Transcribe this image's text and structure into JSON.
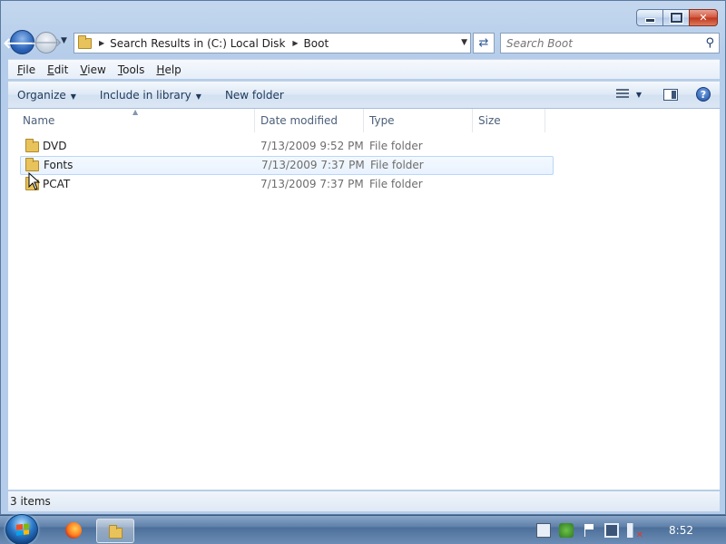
{
  "window": {
    "controls": {
      "minimize": "",
      "maximize": "",
      "close": "✕"
    }
  },
  "navbar": {
    "back_glyph": "🡐",
    "forward_glyph": "🡒",
    "breadcrumbs": [
      {
        "label": "Search Results in (C:) Local Disk"
      },
      {
        "label": "Boot"
      }
    ],
    "refresh_glyph": "⇄",
    "search_placeholder": "Search Boot",
    "search_glyph": "⚲"
  },
  "menubar": {
    "items": [
      {
        "key": "F",
        "rest": "ile"
      },
      {
        "key": "E",
        "rest": "dit"
      },
      {
        "key": "V",
        "rest": "iew"
      },
      {
        "key": "T",
        "rest": "ools"
      },
      {
        "key": "H",
        "rest": "elp"
      }
    ]
  },
  "cmdbar": {
    "organize": "Organize",
    "include": "Include in library",
    "new_folder": "New folder",
    "help_glyph": "?"
  },
  "columns": {
    "name": "Name",
    "date": "Date modified",
    "type": "Type",
    "size": "Size"
  },
  "files": [
    {
      "name": "DVD",
      "date": "7/13/2009 9:52 PM",
      "type": "File folder",
      "icon": "folder-icon"
    },
    {
      "name": "Fonts",
      "date": "7/13/2009 7:37 PM",
      "type": "File folder",
      "icon": "folder-icon"
    },
    {
      "name": "PCAT",
      "date": "7/13/2009 7:37 PM",
      "type": "File folder",
      "icon": "folder-icon"
    }
  ],
  "status": {
    "item_count": "3 items"
  },
  "taskbar": {
    "clock": "8:52"
  },
  "colors": {
    "accent": "#2b63b8",
    "hover_row": "#e8f2fe",
    "folder": "#e8c25a"
  }
}
